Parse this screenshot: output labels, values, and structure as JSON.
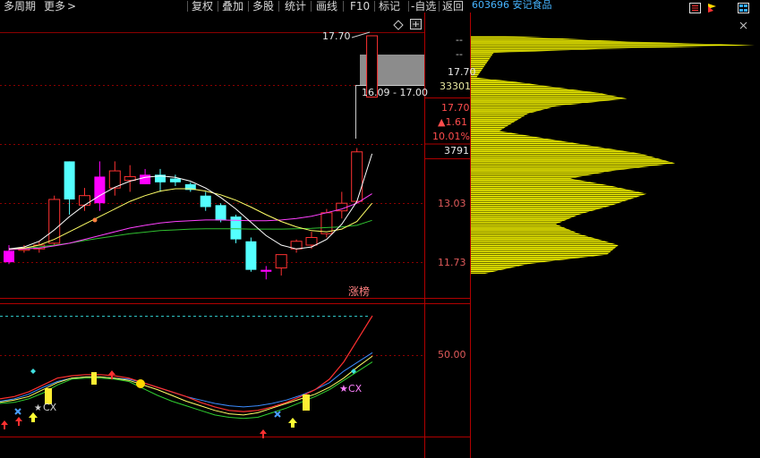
{
  "toolbar": {
    "period": "多周期",
    "more": "更多",
    "more_arrow": ">",
    "buttons": [
      "复权",
      "叠加",
      "多股",
      "统计",
      "画线",
      "F10",
      "标记",
      "-自选",
      "返回"
    ]
  },
  "stock": {
    "code": "603696",
    "name": "安记食品"
  },
  "price_axis": {
    "marks": [
      {
        "text": "17.70",
        "color": "#e8e8e8"
      },
      {
        "text": "13.03",
        "color": "#e05a5a"
      },
      {
        "text": "11.73",
        "color": "#e05a5a"
      }
    ],
    "dashes": [
      "--",
      "--"
    ]
  },
  "quote_box": {
    "price": "17.70",
    "volume": "33301",
    "high": "17.70",
    "change": "▲1.61",
    "pct": "10.01%",
    "low_count": "3791"
  },
  "annotations": {
    "top_price": "17.70",
    "range": "16.09 - 17.00",
    "limit_up_tag": "涨榜"
  },
  "indicator": {
    "axis_label": "50.00",
    "cx_label_1": "CX",
    "cx_label_2": "CX"
  },
  "colors": {
    "up": "#ff3232",
    "down": "#54ffff",
    "magenta": "#ff00ff",
    "ma_white": "#ffffff",
    "ma_yellow": "#ffff66",
    "ma_magenta": "#ff40ff",
    "ma_green": "#30c030",
    "profile": "#ffff00",
    "grid_red": "#8b0000"
  },
  "chart_data": {
    "type": "candlestick",
    "price_ticks": [
      17.7,
      13.03,
      11.73
    ],
    "candles": [
      {
        "o": 12.05,
        "h": 12.2,
        "l": 11.7,
        "c": 11.75,
        "color": "magenta"
      },
      {
        "o": 12.1,
        "h": 12.2,
        "l": 12.0,
        "c": 12.1,
        "color": "up"
      },
      {
        "o": 12.1,
        "h": 12.3,
        "l": 12.0,
        "c": 12.2,
        "color": "up"
      },
      {
        "o": 12.25,
        "h": 13.5,
        "l": 12.2,
        "c": 13.4,
        "color": "up"
      },
      {
        "o": 13.4,
        "h": 14.4,
        "l": 13.0,
        "c": 14.4,
        "color": "down"
      },
      {
        "o": 13.25,
        "h": 13.7,
        "l": 13.1,
        "c": 13.5,
        "color": "up"
      },
      {
        "o": 13.3,
        "h": 14.4,
        "l": 13.1,
        "c": 14.0,
        "color": "magenta"
      },
      {
        "o": 13.7,
        "h": 14.4,
        "l": 13.5,
        "c": 14.15,
        "color": "up"
      },
      {
        "o": 13.9,
        "h": 14.3,
        "l": 13.6,
        "c": 14.0,
        "color": "up"
      },
      {
        "o": 14.05,
        "h": 14.2,
        "l": 13.8,
        "c": 13.8,
        "color": "magenta"
      },
      {
        "o": 14.05,
        "h": 14.2,
        "l": 13.6,
        "c": 13.85,
        "color": "down"
      },
      {
        "o": 13.95,
        "h": 14.05,
        "l": 13.75,
        "c": 13.85,
        "color": "down"
      },
      {
        "o": 13.8,
        "h": 13.85,
        "l": 13.6,
        "c": 13.65,
        "color": "down"
      },
      {
        "o": 13.5,
        "h": 13.6,
        "l": 13.1,
        "c": 13.2,
        "color": "down"
      },
      {
        "o": 13.25,
        "h": 13.3,
        "l": 12.8,
        "c": 12.85,
        "color": "down"
      },
      {
        "o": 12.95,
        "h": 13.0,
        "l": 12.25,
        "c": 12.35,
        "color": "down"
      },
      {
        "o": 12.3,
        "h": 12.4,
        "l": 11.5,
        "c": 11.55,
        "color": "down"
      },
      {
        "o": 11.55,
        "h": 11.65,
        "l": 11.3,
        "c": 11.5,
        "color": "magenta"
      },
      {
        "o": 11.6,
        "h": 11.9,
        "l": 11.4,
        "c": 11.95,
        "color": "up"
      },
      {
        "o": 12.1,
        "h": 12.35,
        "l": 12.0,
        "c": 12.3,
        "color": "up"
      },
      {
        "o": 12.2,
        "h": 12.55,
        "l": 12.1,
        "c": 12.4,
        "color": "up"
      },
      {
        "o": 12.5,
        "h": 13.15,
        "l": 12.4,
        "c": 13.05,
        "color": "up"
      },
      {
        "o": 13.1,
        "h": 13.6,
        "l": 12.9,
        "c": 13.3,
        "color": "up"
      },
      {
        "o": 13.35,
        "h": 14.75,
        "l": 13.3,
        "c": 14.65,
        "color": "up"
      },
      {
        "o": 16.09,
        "h": 17.7,
        "l": 16.09,
        "c": 17.7,
        "color": "up"
      }
    ],
    "ma_white": [
      12.1,
      12.15,
      12.3,
      12.6,
      12.95,
      13.25,
      13.5,
      13.72,
      13.88,
      13.98,
      14.02,
      13.98,
      13.88,
      13.7,
      13.45,
      13.15,
      12.8,
      12.45,
      12.2,
      12.1,
      12.15,
      12.35,
      12.75,
      13.35,
      14.6
    ],
    "ma_yellow": [
      12.1,
      12.12,
      12.2,
      12.35,
      12.55,
      12.75,
      12.95,
      13.15,
      13.35,
      13.5,
      13.62,
      13.68,
      13.68,
      13.62,
      13.52,
      13.38,
      13.2,
      13.0,
      12.82,
      12.68,
      12.58,
      12.55,
      12.62,
      12.82,
      13.3
    ],
    "ma_magenta": [
      12.08,
      12.1,
      12.12,
      12.18,
      12.25,
      12.35,
      12.45,
      12.55,
      12.65,
      12.72,
      12.78,
      12.82,
      12.84,
      12.86,
      12.86,
      12.85,
      12.84,
      12.84,
      12.86,
      12.9,
      12.96,
      13.05,
      13.15,
      13.3,
      13.55
    ],
    "ma_green": [
      12.1,
      12.12,
      12.15,
      12.2,
      12.25,
      12.32,
      12.38,
      12.44,
      12.5,
      12.54,
      12.58,
      12.6,
      12.62,
      12.63,
      12.63,
      12.63,
      12.62,
      12.62,
      12.62,
      12.63,
      12.64,
      12.66,
      12.68,
      12.72,
      12.85
    ],
    "volume_profile": [
      {
        "price": 17.7,
        "size": 0.12
      },
      {
        "price": 17.55,
        "size": 0.55
      },
      {
        "price": 17.45,
        "size": 1.0
      },
      {
        "price": 17.35,
        "size": 0.45
      },
      {
        "price": 17.25,
        "size": 0.08
      },
      {
        "price": 16.6,
        "size": 0.02
      },
      {
        "price": 16.5,
        "size": 0.15
      },
      {
        "price": 16.2,
        "size": 0.45
      },
      {
        "price": 16.05,
        "size": 0.55
      },
      {
        "price": 15.85,
        "size": 0.3
      },
      {
        "price": 15.65,
        "size": 0.2
      },
      {
        "price": 15.2,
        "size": 0.1
      },
      {
        "price": 14.9,
        "size": 0.35
      },
      {
        "price": 14.6,
        "size": 0.6
      },
      {
        "price": 14.35,
        "size": 0.72
      },
      {
        "price": 14.15,
        "size": 0.5
      },
      {
        "price": 13.95,
        "size": 0.35
      },
      {
        "price": 13.75,
        "size": 0.5
      },
      {
        "price": 13.55,
        "size": 0.62
      },
      {
        "price": 13.25,
        "size": 0.5
      },
      {
        "price": 13.0,
        "size": 0.38
      },
      {
        "price": 12.75,
        "size": 0.3
      },
      {
        "price": 12.5,
        "size": 0.38
      },
      {
        "price": 12.2,
        "size": 0.52
      },
      {
        "price": 11.95,
        "size": 0.48
      },
      {
        "price": 11.7,
        "size": 0.2
      },
      {
        "price": 11.45,
        "size": 0.05
      }
    ],
    "indicator_level": 50.0,
    "indicator_red": [
      28,
      30,
      34,
      40,
      46,
      48,
      49,
      49,
      48,
      46,
      42,
      38,
      34,
      30,
      25,
      21,
      18,
      17,
      18,
      21,
      25,
      30,
      36,
      45,
      60,
      80,
      100
    ],
    "indicator_yellow": [
      25,
      27,
      30,
      36,
      42,
      46,
      47,
      47,
      46,
      44,
      40,
      36,
      31,
      26,
      22,
      18,
      15,
      14,
      16,
      20,
      24,
      28,
      32,
      38,
      46,
      56,
      65
    ],
    "indicator_blue": [
      26,
      28,
      32,
      38,
      43,
      46,
      47,
      47,
      46,
      45,
      42,
      38,
      34,
      30,
      27,
      24,
      22,
      21,
      22,
      24,
      27,
      31,
      36,
      42,
      52,
      60,
      68
    ],
    "indicator_green": [
      24,
      25,
      28,
      33,
      40,
      45,
      46,
      46,
      45,
      43,
      37,
      31,
      26,
      22,
      18,
      14,
      12,
      11,
      12,
      16,
      20,
      25,
      30,
      36,
      44,
      52,
      60
    ]
  }
}
